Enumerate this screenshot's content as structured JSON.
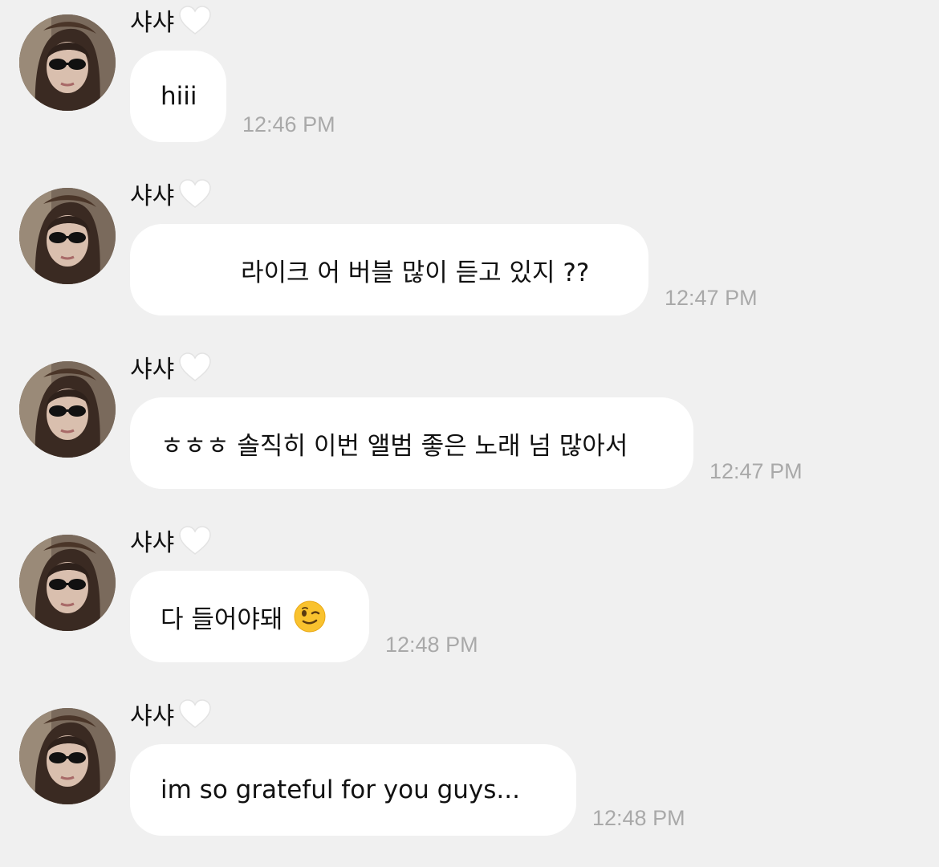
{
  "messages": [
    {
      "sender": "샤샤",
      "text": "hiii",
      "time": "12:46 PM"
    },
    {
      "sender": "샤샤",
      "text": "라이크 어 버블 많이 듣고 있지 ??",
      "time": "12:47 PM"
    },
    {
      "sender": "샤샤",
      "text": "ㅎㅎㅎ 솔직히 이번 앨범 좋은 노래 넘 많아서",
      "time": "12:47 PM"
    },
    {
      "sender": "샤샤",
      "text": "다 들어야돼",
      "emoji": "winking-face-emoji",
      "time": "12:48 PM"
    },
    {
      "sender": "샤샤",
      "text": "im so grateful for you guys...",
      "time": "12:48 PM"
    }
  ],
  "icons": {
    "sender_badge": "white-heart-icon",
    "avatar": "profile-avatar"
  },
  "colors": {
    "background": "#f0f0f0",
    "bubble": "#ffffff",
    "timestamp": "#a9a9a9",
    "text": "#111111"
  }
}
